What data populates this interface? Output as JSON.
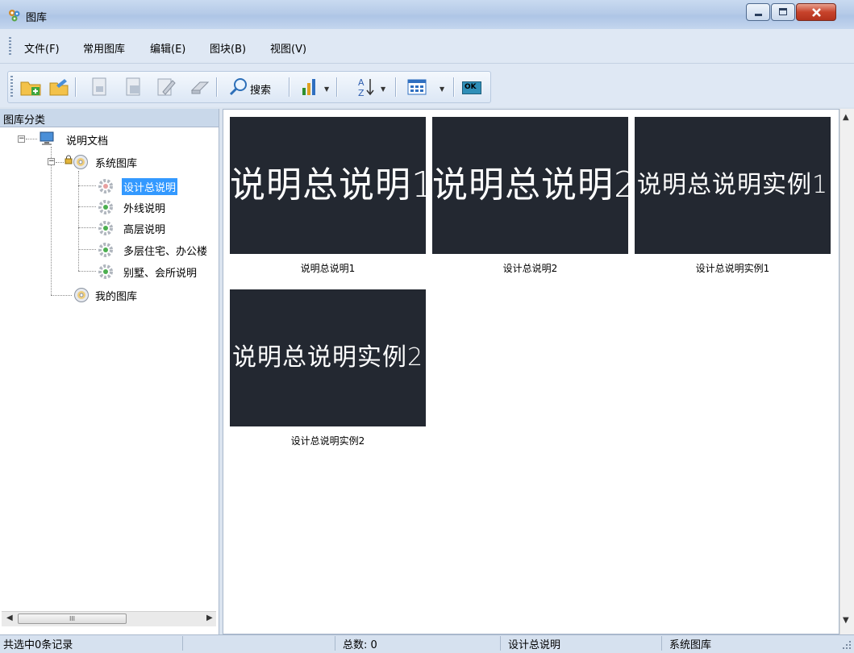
{
  "window": {
    "title": "图库"
  },
  "menu": [
    {
      "label": "文件(F)"
    },
    {
      "label": "常用图库"
    },
    {
      "label": "编辑(E)"
    },
    {
      "label": "图块(B)"
    },
    {
      "label": "视图(V)"
    }
  ],
  "toolbar": {
    "search_label": "搜索",
    "ok_label": "OK"
  },
  "left_panel": {
    "header": "图库分类",
    "tree": {
      "root": "说明文档",
      "system_lib": "系统图库",
      "items": [
        "设计总说明",
        "外线说明",
        "高层说明",
        "多层住宅、办公楼",
        "别墅、会所说明"
      ],
      "selected_index": 0,
      "my_lib": "我的图库"
    },
    "hscroll_thumb_glyph": "III"
  },
  "thumbnails": [
    {
      "image_text": "说明总说明1",
      "label": "说明总说明1"
    },
    {
      "image_text": "说明总说明2",
      "label": "设计总说明2"
    },
    {
      "image_text": "说明总说明实例1",
      "label": "设计总说明实例1"
    },
    {
      "image_text": "说明总说明实例2",
      "label": "设计总说明实例2"
    }
  ],
  "status": {
    "selected": "共选中0条记录",
    "total": "总数: 0",
    "category": "设计总说明",
    "library": "系统图库"
  }
}
